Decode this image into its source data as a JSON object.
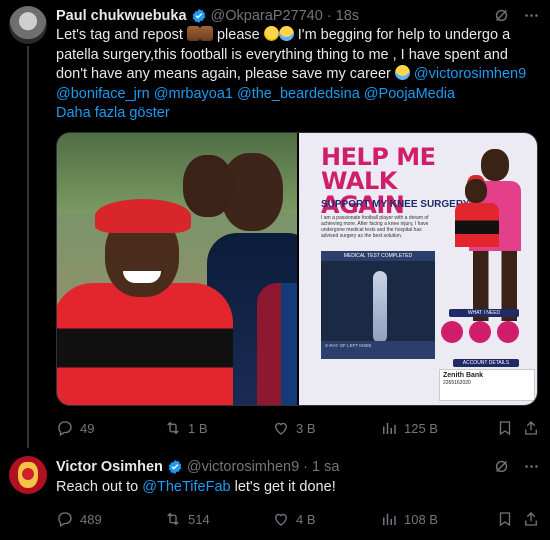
{
  "tweet1": {
    "name": "Paul chukwuebuka",
    "handle": "@OkparaP27740",
    "time": "18s",
    "text_1": "Let's tag and repost ",
    "text_2": " please ",
    "text_3": " I'm begging for help to undergo a patella surgery,this football is everything thing to me , I have spent and don't have any means again, please save my career ",
    "mention_1": "@victorosimhen9",
    "mention_2": "@boniface_jrn",
    "mention_3": "@mrbayoa1",
    "mention_4": "@the_beardedsina",
    "mention_5": "@PoojaMedia",
    "show_more": "Daha fazla göster",
    "poster": {
      "title": "HELP ME WALK AGAIN",
      "subtitle": "SUPPORT MY KNEE SURGERY",
      "body": "I am a passionate football player with a dream of achieving more. After facing a knee injury, I have undergone medical tests and the hospital has advised surgery as the best solution.",
      "test_header": "MEDICAL TEST COMPLETED",
      "xray_caption": "X-RAY OF LEFT KNEE",
      "need_label": "WHAT I NEED",
      "account_label": "ACCOUNT DETAILS",
      "bank_name": "Zenith Bank",
      "account_number": "2265162020"
    },
    "actions": {
      "replies": "49",
      "reposts": "1 B",
      "likes": "3 B",
      "views": "125 B"
    }
  },
  "tweet2": {
    "name": "Victor Osimhen",
    "handle": "@victorosimhen9",
    "time": "1 sa",
    "text_1": "Reach out to ",
    "mention": "@TheTifeFab",
    "text_2": " let's get it done!",
    "actions": {
      "replies": "489",
      "reposts": "514",
      "likes": "4 B",
      "views": "108 B"
    }
  },
  "colors": {
    "background": "#000000",
    "text": "#e7e9ea",
    "muted": "#71767b",
    "link": "#1d9bf0",
    "verified": "#1d9bf0"
  },
  "icons": [
    "verified-badge-icon",
    "grok-icon",
    "more-icon",
    "reply-icon",
    "repost-icon",
    "like-icon",
    "views-icon",
    "bookmark-icon",
    "share-icon"
  ]
}
